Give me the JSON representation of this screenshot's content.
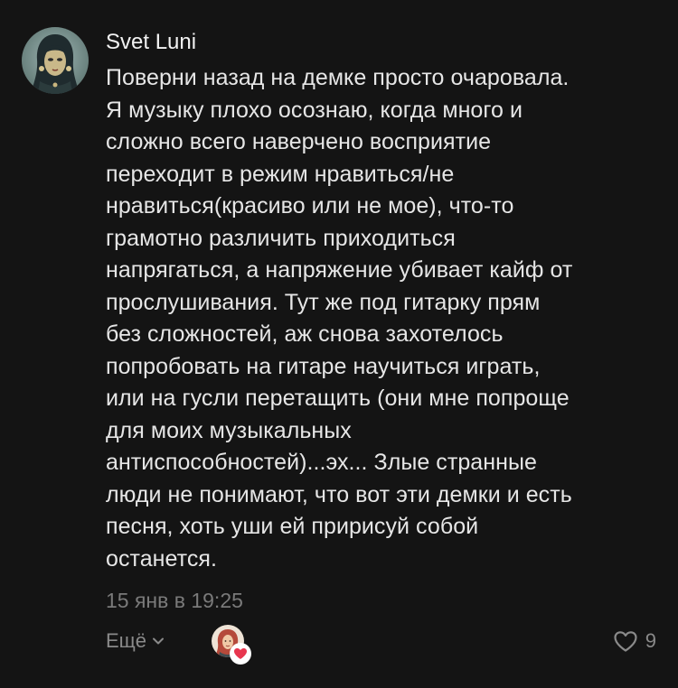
{
  "comment": {
    "author": "Svet Luni",
    "text_lines": [
      "Поверни назад на демке просто очаровала.",
      "Я музыку плохо осознаю, когда много и",
      "сложно всего наверчено восприятие",
      "переходит в режим нравиться/не",
      "нравиться(красиво или не мое), что-то",
      "грамотно различить приходиться",
      "напрягаться, а напряжение убивает кайф от",
      "прослушивания. Тут же под гитарку прям",
      "без сложностей, аж снова захотелось",
      "попробовать на гитаре научиться играть,",
      "или на гусли перетащить (они мне попроще",
      "для моих музыкальных",
      "антиспособностей)...эх... Злые странные",
      "люди не понимают, что вот эти демки и есть",
      "песня, хоть уши ей пририсуй собой",
      "останется."
    ],
    "timestamp": "15 янв в 19:25"
  },
  "actions": {
    "more_label": "Ещё",
    "like_count": "9"
  },
  "icons": {
    "more": "chevron-down-icon",
    "like": "heart-outline-icon",
    "reaction": "heart-filled-icon"
  },
  "colors": {
    "background": "#141414",
    "text": "#e6e6e6",
    "secondary": "#7a7a7a",
    "reaction_heart": "#e8364f"
  }
}
